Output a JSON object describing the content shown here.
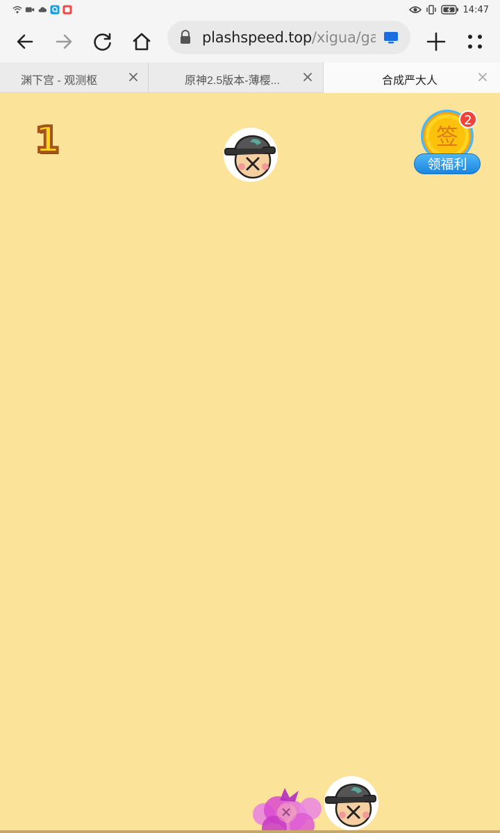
{
  "status_bar": {
    "time": "14:47",
    "left_icons": [
      "wifi-icon",
      "video-icon",
      "cloud-icon",
      "qq-icon",
      "app-icon"
    ],
    "right_icons": [
      "eye-icon",
      "vibrate-icon",
      "battery-icon"
    ]
  },
  "toolbar": {
    "url_host": "plashspeed.top",
    "url_path": "/xigua/ga",
    "icons": [
      "back-icon",
      "forward-icon",
      "reload-icon",
      "home-icon",
      "lock-icon",
      "cast-icon",
      "new-tab-icon",
      "menu-icon"
    ]
  },
  "tabs": [
    {
      "title": "渊下宫 - 观测枢",
      "active": false
    },
    {
      "title": "原神2.5版本-薄樱...",
      "active": false
    },
    {
      "title": "合成严大人",
      "active": true
    }
  ],
  "game": {
    "score": "1",
    "welfare": {
      "sign_char": "签",
      "label": "领福利",
      "badge_count": "2"
    }
  },
  "colors": {
    "background": "#fbe39a",
    "score_fill": "#ffd21f",
    "score_stroke": "#a4541a",
    "welfare_blue": "#1b86e0",
    "badge_red": "#f0443a"
  }
}
